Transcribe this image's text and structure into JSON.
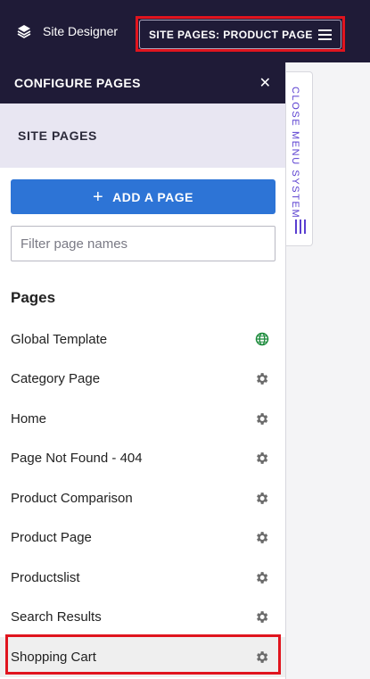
{
  "topbar": {
    "brand_label": "Site Designer",
    "brand_icon": "layers-icon",
    "site_pages_label": "SITE PAGES: PRODUCT PAGE",
    "menu_icon": "hamburger-icon"
  },
  "panel": {
    "header_title": "CONFIGURE PAGES",
    "close_label": "✕",
    "section_title": "SITE PAGES",
    "add_page_label": "ADD A PAGE",
    "add_page_icon": "plus-icon",
    "filter_placeholder": "Filter page names",
    "filter_value": "",
    "pages_heading": "Pages",
    "pages": [
      {
        "name": "Global Template",
        "icon": "globe-icon",
        "icon_color": "#1a8a3a"
      },
      {
        "name": "Category Page",
        "icon": "gear-icon"
      },
      {
        "name": "Home",
        "icon": "gear-icon"
      },
      {
        "name": "Page Not Found - 404",
        "icon": "gear-icon"
      },
      {
        "name": "Product Comparison",
        "icon": "gear-icon"
      },
      {
        "name": "Product Page",
        "icon": "gear-icon"
      },
      {
        "name": "Productslist",
        "icon": "gear-icon"
      },
      {
        "name": "Search Results",
        "icon": "gear-icon"
      },
      {
        "name": "Shopping Cart",
        "icon": "gear-icon",
        "selected": true
      }
    ]
  },
  "side_tab": {
    "label": "CLOSE MENU SYSTEM",
    "color": "#5a3fd0"
  },
  "colors": {
    "dark_navy": "#1f1b37",
    "primary_blue": "#2d74d6",
    "highlight_red": "#e0141e",
    "section_bg": "#e8e6f2"
  }
}
